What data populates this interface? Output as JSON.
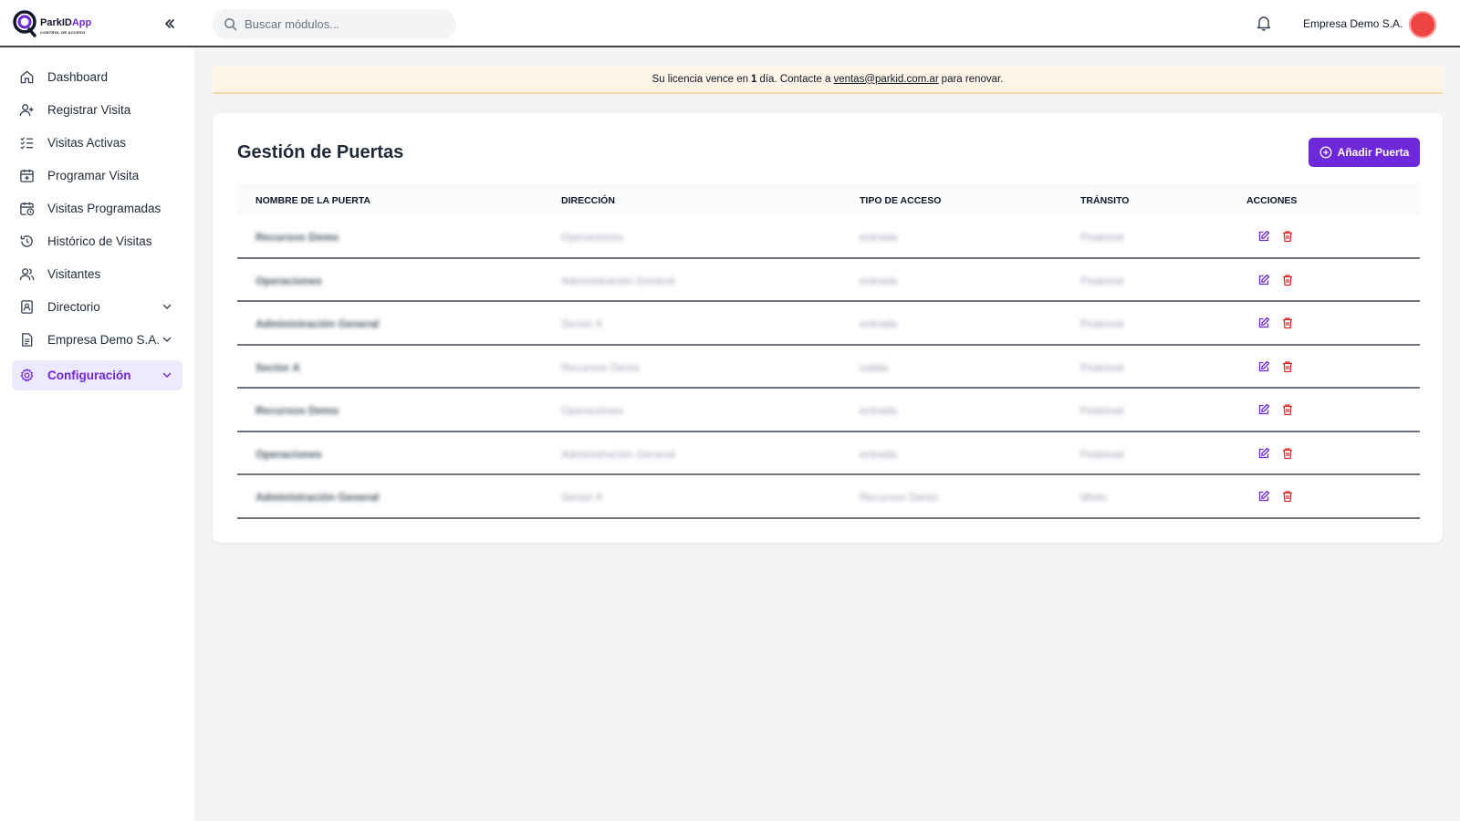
{
  "brand": {
    "name_part1": "ParkID",
    "name_part2": "App",
    "tagline": "CONTROL DE ACCESO"
  },
  "header": {
    "search_placeholder": "Buscar módulos...",
    "company": "Empresa Demo S.A."
  },
  "sidebar": {
    "items": [
      {
        "label": "Dashboard",
        "icon": "home-icon"
      },
      {
        "label": "Registrar Visita",
        "icon": "user-plus-icon"
      },
      {
        "label": "Visitas Activas",
        "icon": "list-check-icon"
      },
      {
        "label": "Programar Visita",
        "icon": "calendar-plus-icon"
      },
      {
        "label": "Visitas Programadas",
        "icon": "calendar-clock-icon"
      },
      {
        "label": "Histórico de Visitas",
        "icon": "history-icon"
      },
      {
        "label": "Visitantes",
        "icon": "users-icon"
      },
      {
        "label": "Directorio",
        "icon": "contact-book-icon"
      },
      {
        "label": "Empresa Demo S.A.",
        "icon": "document-icon"
      },
      {
        "label": "Configuración",
        "icon": "gear-icon"
      }
    ]
  },
  "banner": {
    "text_before": "Su licencia vence en",
    "days": "1",
    "text_mid": "día. Contacte a",
    "email": "ventas@parkid.com.ar",
    "text_after": "para renovar."
  },
  "page": {
    "title": "Gestión de Puertas",
    "add_button": "Añadir Puerta"
  },
  "table": {
    "columns": [
      "NOMBRE DE LA PUERTA",
      "DIRECCIÓN",
      "TIPO DE ACCESO",
      "TRÁNSITO",
      "ACCIONES"
    ],
    "rows": [
      [
        "Recursos Demo",
        "Operaciones",
        "entrada",
        "Peatonal"
      ],
      [
        "Operaciones",
        "Administración General",
        "entrada",
        "Peatonal"
      ],
      [
        "Administración General",
        "Sector A",
        "entrada",
        "Peatonal"
      ],
      [
        "Sector A",
        "Recursos Demo",
        "salida",
        "Peatonal"
      ],
      [
        "Recursos Demo",
        "Operaciones",
        "entrada",
        "Peatonal"
      ],
      [
        "Operaciones",
        "Administración General",
        "entrada",
        "Peatonal"
      ],
      [
        "Administración General",
        "Sector A",
        "Recursos Demo",
        "Mixto"
      ]
    ]
  },
  "colors": {
    "accent": "#6d28d9",
    "danger": "#dc2626",
    "banner_bg": "#fdf4e7"
  }
}
